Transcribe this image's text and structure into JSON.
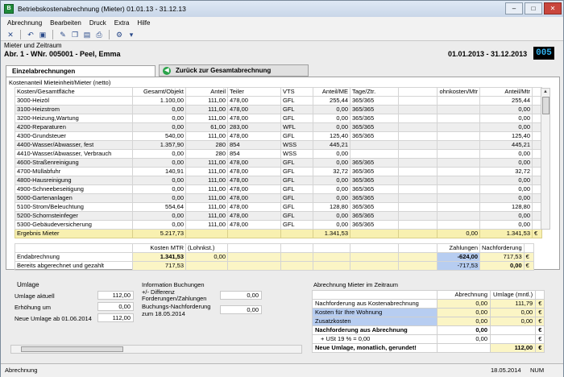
{
  "title": "Betriebskostenabrechnung (Mieter) 01.01.13 - 31.12.13",
  "menu": [
    "Abrechnung",
    "Bearbeiten",
    "Druck",
    "Extra",
    "Hilfe"
  ],
  "header": {
    "caption": "Mieter und Zeitraum",
    "tenant": "Abr. 1 - WNr. 005001 - Peel, Emma",
    "period": "01.01.2013 - 31.12.2013",
    "id": "005"
  },
  "tabs": {
    "active": "Einzelabrechnungen",
    "back": "Zurück zur Gesamtabrechnung"
  },
  "grid": {
    "caption": "Kostenanteil Mieteinheit/Mieter (netto)",
    "columns": [
      "Kosten/Gesamtfläche",
      "Gesamt/Objekt",
      "Anteil",
      "Teiler",
      "VTS",
      "Anteil/ME",
      "Tage/Ztr.",
      "",
      "ohnkosten/Mtr",
      "Anteil/Mtr"
    ],
    "rows": [
      [
        "3000-Heizöl",
        "1.100,00",
        "111,00",
        "478,00",
        "GFL",
        "255,44",
        "365/365",
        "",
        "",
        "255,44"
      ],
      [
        "3100-Heizstrom",
        "0,00",
        "111,00",
        "478,00",
        "GFL",
        "0,00",
        "365/365",
        "",
        "",
        "0,00"
      ],
      [
        "3200-Heizung,Wartung",
        "0,00",
        "111,00",
        "478,00",
        "GFL",
        "0,00",
        "365/365",
        "",
        "",
        "0,00"
      ],
      [
        "4200-Reparaturen",
        "0,00",
        "61,00",
        "283,00",
        "WFL",
        "0,00",
        "365/365",
        "",
        "",
        "0,00"
      ],
      [
        "4300-Grundsteuer",
        "540,00",
        "111,00",
        "478,00",
        "GFL",
        "125,40",
        "365/365",
        "",
        "",
        "125,40"
      ],
      [
        "4400-Wasser/Abwasser, fest",
        "1.357,90",
        "280",
        "854",
        "WSS",
        "445,21",
        "",
        "",
        "",
        "445,21"
      ],
      [
        "4410-Wasser/Abwasser, Verbrauch",
        "0,00",
        "280",
        "854",
        "WSS",
        "0,00",
        "",
        "",
        "",
        "0,00"
      ],
      [
        "4600-Straßenreinigung",
        "0,00",
        "111,00",
        "478,00",
        "GFL",
        "0,00",
        "365/365",
        "",
        "",
        "0,00"
      ],
      [
        "4700-Müllabfuhr",
        "140,91",
        "111,00",
        "478,00",
        "GFL",
        "32,72",
        "365/365",
        "",
        "",
        "32,72"
      ],
      [
        "4800-Hausreinigung",
        "0,00",
        "111,00",
        "478,00",
        "GFL",
        "0,00",
        "365/365",
        "",
        "",
        "0,00"
      ],
      [
        "4900-Schneebeseitigung",
        "0,00",
        "111,00",
        "478,00",
        "GFL",
        "0,00",
        "365/365",
        "",
        "",
        "0,00"
      ],
      [
        "5000-Gartenanlagen",
        "0,00",
        "111,00",
        "478,00",
        "GFL",
        "0,00",
        "365/365",
        "",
        "",
        "0,00"
      ],
      [
        "5100-Strom/Beleuchtung",
        "554,64",
        "111,00",
        "478,00",
        "GFL",
        "128,80",
        "365/365",
        "",
        "",
        "128,80"
      ],
      [
        "5200-Schornsteinfeger",
        "0,00",
        "111,00",
        "478,00",
        "GFL",
        "0,00",
        "365/365",
        "",
        "",
        "0,00"
      ],
      [
        "5300-Gebäudeversicherung",
        "0,00",
        "111,00",
        "478,00",
        "GFL",
        "0,00",
        "365/365",
        "",
        "",
        "0,00"
      ]
    ],
    "sum": {
      "label": "Ergebnis Mieter",
      "gesamt": "5.217,73",
      "anteil_me": "1.341,53",
      "ohnkosten": "0,00",
      "anteil_mtr": "1.341,53",
      "cur": "€"
    }
  },
  "bottom": {
    "kosten_mtr": "Kosten MTR",
    "lohnkst": "(Lohnkst.)",
    "zahlungen": "Zahlungen",
    "nachforderung": "Nachforderung",
    "end_label": "Endabrechnung",
    "end_kosten": "1.341,53",
    "end_lohn": "0,00",
    "end_zahl": "-624,00",
    "end_nach": "717,53",
    "ber_label": "Bereits abgerechnet und gezahlt",
    "ber_kosten": "717,53",
    "ber_zahl": "-717,53",
    "ber_nach": "0,00",
    "cur": "€"
  },
  "umlage": {
    "title": "Umlage",
    "aktuell_label": "Umlage aktuell",
    "aktuell": "112,00",
    "erhoehung_label": "Erhöhung um",
    "erhoehung": "0,00",
    "neu_label": "Neue Umlage ab 01.06.2014",
    "neu": "112,00"
  },
  "info": {
    "title": "Information Buchungen",
    "diff_label1": "+/- Differenz",
    "diff_label2": "Forderungen/Zahlungen",
    "diff": "0,00",
    "nach_label1": "Buchungs-Nachforderung",
    "nach_label2": "zum 18.05.2014",
    "nach": "0,00"
  },
  "abrechnung": {
    "title": "Abrechnung Mieter im Zeitraum",
    "col1": "Abrechnung",
    "col2": "Umlage (mntl.)",
    "rows": [
      {
        "label": "Nachforderung aus Kostenabrechnung",
        "a": "0,00",
        "u": "111,79",
        "c": "€"
      },
      {
        "label": "Kosten für Ihre Wohnung",
        "a": "0,00",
        "u": "0,00",
        "c": "€"
      },
      {
        "label": "Zusatzkosten",
        "a": "0,00",
        "u": "0,00",
        "c": "€"
      }
    ],
    "nach_label": "Nachforderung aus Abrechnung",
    "nach_a": "0,00",
    "nach_c": "€",
    "ust_label": "+ USt 19 % = 0,00",
    "ust_a": "0,00",
    "ust_c": "€",
    "neu_label": "Neue Umlage, monatlich, gerundet!",
    "neu_u": "112,00",
    "neu_c": "€"
  },
  "status": {
    "left": "Abrechnung",
    "date": "18.05.2014",
    "mode": "NUM"
  }
}
